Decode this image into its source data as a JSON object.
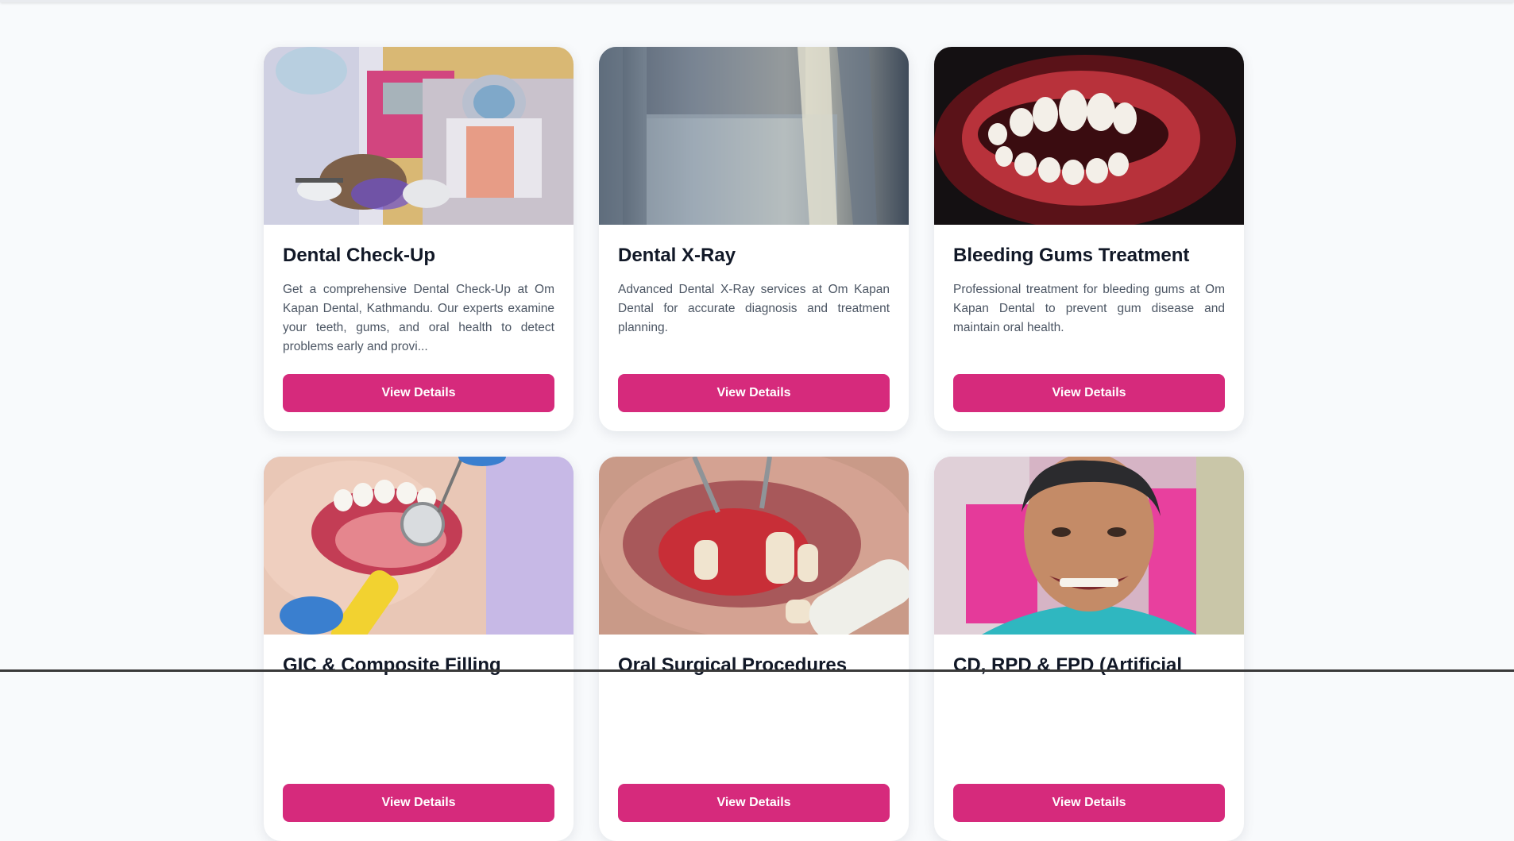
{
  "cards": [
    {
      "title": "Dental Check-Up",
      "description": "Get a comprehensive Dental Check-Up at Om Kapan Dental, Kathmandu. Our experts examine your teeth, gums, and oral health to detect problems early and provi...",
      "button": "View Details",
      "image": "dentist-examining-patient-photo"
    },
    {
      "title": "Dental X-Ray",
      "description": "Advanced Dental X-Ray services at Om Kapan Dental for accurate diagnosis and treatment planning.",
      "button": "View Details",
      "image": "dental-xray-photo"
    },
    {
      "title": "Bleeding Gums Treatment",
      "description": "Professional treatment for bleeding gums at Om Kapan Dental to prevent gum disease and maintain oral health.",
      "button": "View Details",
      "image": "bleeding-gums-photo"
    },
    {
      "title": "GIC & Composite Filling",
      "description": "",
      "button": "View Details",
      "image": "dental-mirror-mouth-photo"
    },
    {
      "title": "Oral Surgical Procedures",
      "description": "",
      "button": "View Details",
      "image": "oral-surgery-photo"
    },
    {
      "title": "CD, RPD & FPD (Artificial",
      "description": "",
      "button": "View Details",
      "image": "smiling-patient-photo"
    }
  ],
  "colors": {
    "accent": "#d62a7c",
    "background": "#f8fafc",
    "title": "#111827",
    "text": "#4b5563"
  }
}
